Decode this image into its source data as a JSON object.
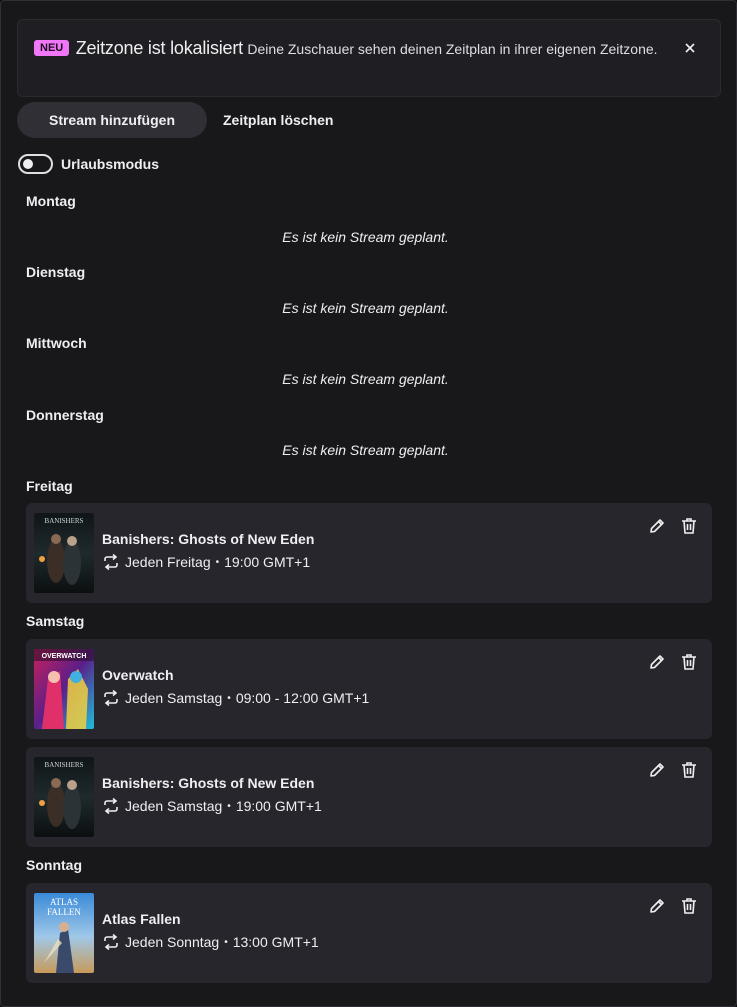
{
  "banner": {
    "badge": "NEU",
    "title": "Zeitzone ist lokalisiert",
    "text": "Deine Zuschauer sehen deinen Zeitplan in ihrer eigenen Zeitzone."
  },
  "buttons": {
    "add_stream": "Stream hinzufügen",
    "delete_schedule": "Zeitplan löschen"
  },
  "vacation": {
    "label": "Urlaubsmodus",
    "enabled": false
  },
  "empty_text": "Es ist kein Stream geplant.",
  "days": {
    "monday": "Montag",
    "tuesday": "Dienstag",
    "wednesday": "Mittwoch",
    "thursday": "Donnerstag",
    "friday": "Freitag",
    "saturday": "Samstag",
    "sunday": "Sonntag"
  },
  "streams": {
    "fri1": {
      "title": "Banishers: Ghosts of New Eden",
      "repeat": "Jeden Freitag",
      "time": "19:00 GMT+1",
      "thumb_text": "BANISHERS"
    },
    "sat1": {
      "title": "Overwatch",
      "repeat": "Jeden Samstag",
      "time": "09:00 - 12:00 GMT+1",
      "thumb_text": "OVERWATCH"
    },
    "sat2": {
      "title": "Banishers: Ghosts of New Eden",
      "repeat": "Jeden Samstag",
      "time": "19:00 GMT+1",
      "thumb_text": "BANISHERS"
    },
    "sun1": {
      "title": "Atlas Fallen",
      "repeat": "Jeden Sonntag",
      "time": "13:00 GMT+1",
      "thumb_text_1": "ATLAS",
      "thumb_text_2": "FALLEN"
    }
  },
  "icons": {
    "close": "close-icon",
    "repeat": "repeat-icon",
    "edit": "pencil-icon",
    "delete": "trash-icon"
  },
  "colors": {
    "badge": "#f276f8",
    "background": "#18181b",
    "card": "#26262c"
  }
}
